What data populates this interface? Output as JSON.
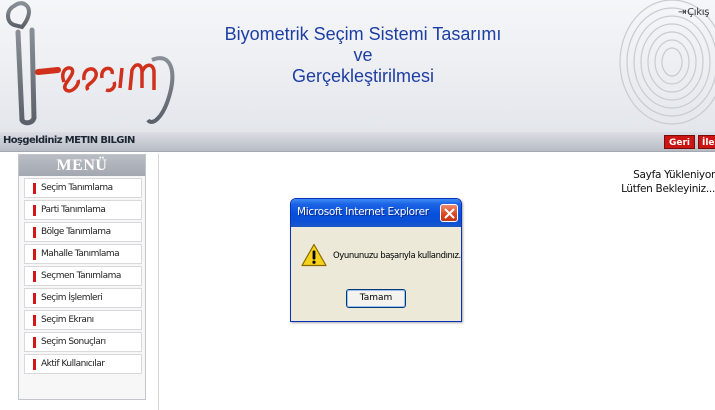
{
  "header": {
    "logo_text": "i-seçim",
    "title_lines": [
      "Biyometrik Seçim Sistemi Tasarımı",
      "ve",
      "Gerçekleştirilmesi"
    ],
    "exit_label": "Çıkış"
  },
  "welcome_bar": {
    "text": "Hoşgeldiniz METIN BILGIN",
    "back_label": "Geri",
    "forward_label": "İleri"
  },
  "menu": {
    "title": "MENÜ",
    "items": [
      {
        "label": "Seçim Tanımlama"
      },
      {
        "label": "Parti Tanımlama"
      },
      {
        "label": "Bölge Tanımlama"
      },
      {
        "label": "Mahalle Tanımlama"
      },
      {
        "label": "Seçmen Tanımlama"
      },
      {
        "label": "Seçim İşlemleri"
      },
      {
        "label": "Seçim Ekranı"
      },
      {
        "label": "Seçim Sonuçları"
      },
      {
        "label": "Aktif Kullanıcılar"
      }
    ]
  },
  "content": {
    "loading_line1": "Sayfa Yükleniyor",
    "loading_line2": "Lütfen Bekleyiniz..."
  },
  "dialog": {
    "title": "Microsoft Internet Explorer",
    "message": "Oyununuzu başarıyla kullandınız.",
    "ok_label": "Tamam",
    "icon": "warning-icon"
  },
  "colors": {
    "title_blue": "#1d3ea3",
    "accent_red": "#cc1412",
    "xp_title_blue": "#0550dc"
  }
}
